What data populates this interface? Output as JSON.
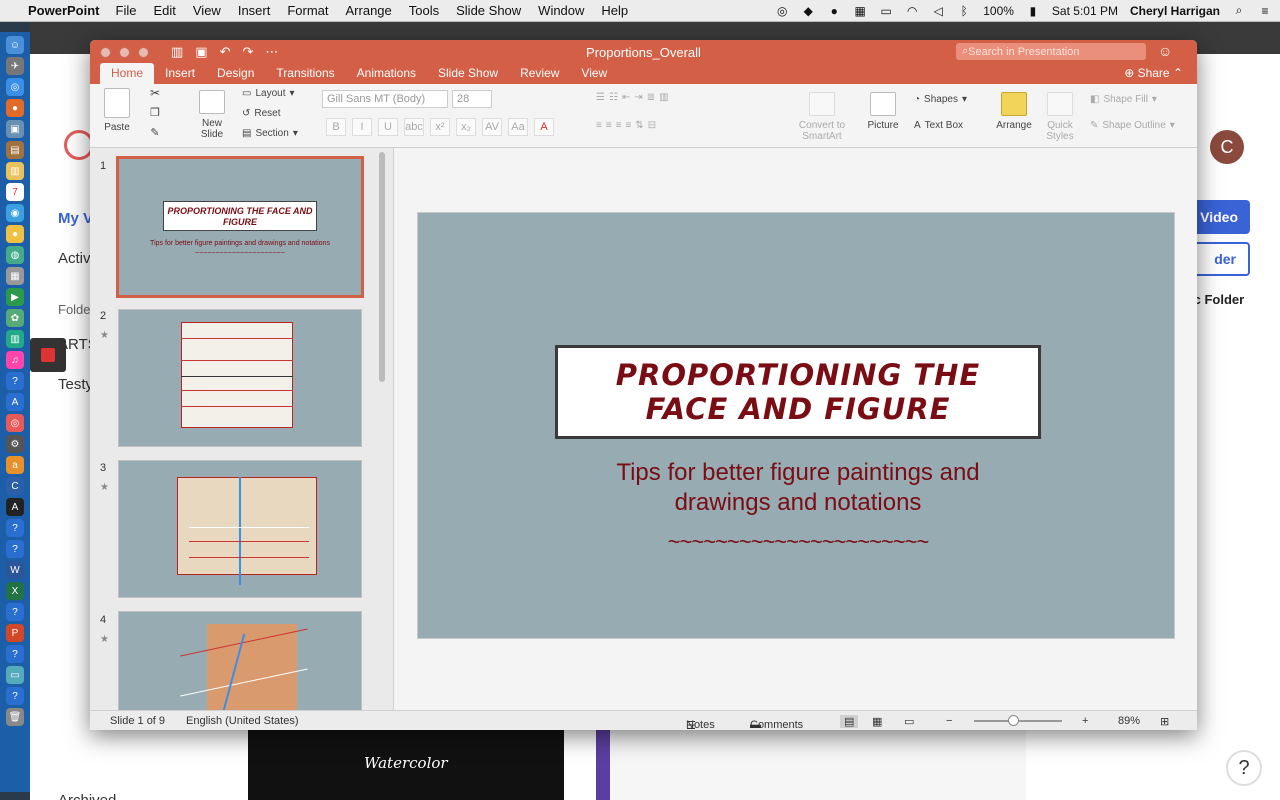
{
  "menubar": {
    "apple": "",
    "app": "PowerPoint",
    "items": [
      "File",
      "Edit",
      "View",
      "Insert",
      "Format",
      "Arrange",
      "Tools",
      "Slide Show",
      "Window",
      "Help"
    ],
    "battery": "100%",
    "clock": "Sat 5:01 PM",
    "user": "Cheryl Harrigan"
  },
  "browser": {
    "my_link": "My V",
    "activity_link": "Activ",
    "folders_label": "Folde",
    "arts": "ARTS",
    "testy": "Testy",
    "archived": "Archived",
    "avatar_letter": "C",
    "video_button": "Video",
    "folder_button": "der",
    "public_folder": "ic Folder",
    "help": "?",
    "thumb_text": "Watercolor"
  },
  "ppt": {
    "window_title": "Proportions_Overall",
    "search_placeholder": "Search in Presentation",
    "tabs": [
      "Home",
      "Insert",
      "Design",
      "Transitions",
      "Animations",
      "Slide Show",
      "Review",
      "View"
    ],
    "share": "Share",
    "ribbon": {
      "paste": "Paste",
      "new_slide_1": "New",
      "new_slide_2": "Slide",
      "layout": "Layout",
      "reset": "Reset",
      "section": "Section",
      "font": "Gill Sans MT (Body)",
      "size": "28",
      "convert_1": "Convert to",
      "convert_2": "SmartArt",
      "picture": "Picture",
      "shapes": "Shapes",
      "textbox": "Text Box",
      "arrange": "Arrange",
      "quick_1": "Quick",
      "quick_2": "Styles",
      "shape_fill": "Shape Fill",
      "shape_outline": "Shape Outline"
    },
    "slides": [
      {
        "num": "1",
        "title": "PROPORTIONING THE FACE AND FIGURE",
        "sub": "Tips for better figure paintings and drawings and notations",
        "tilde": "~~~~~~~~~~~~~~~~~~~~~~"
      },
      {
        "num": "2",
        "star": "★"
      },
      {
        "num": "3",
        "star": "★"
      },
      {
        "num": "4",
        "star": "★"
      }
    ],
    "main_slide": {
      "title_line1": "PROPORTIONING THE",
      "title_line2": "FACE AND FIGURE",
      "subtitle_line1": "Tips for better figure paintings and",
      "subtitle_line2": "drawings and notations",
      "tilde": "~~~~~~~~~~~~~~~~~~~~~~"
    },
    "status": {
      "slide": "Slide 1 of 9",
      "lang": "English (United States)",
      "notes": "Notes",
      "comments": "Comments",
      "zoom": "89%"
    }
  }
}
